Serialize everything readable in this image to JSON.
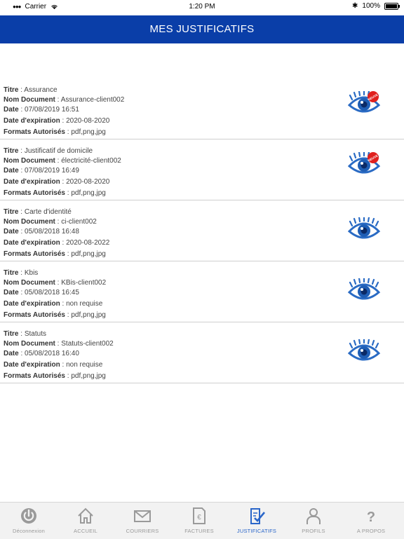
{
  "status_bar": {
    "carrier": "Carrier",
    "time": "1:20 PM",
    "battery": "100%",
    "battery_level": 1.0
  },
  "header": {
    "title": "MES JUSTIFICATIFS"
  },
  "labels": {
    "title": "Titre",
    "doc_name": "Nom Document",
    "date": "Date",
    "expiration": "Date d'expiration",
    "formats": "Formats Autorisés"
  },
  "documents": [
    {
      "titre": "Assurance",
      "nom": "Assurance-client002",
      "date": "07/08/2019 16:51",
      "expiration": "2020-08-2020",
      "formats": "pdf,png,jpg",
      "badge": "NEUVE"
    },
    {
      "titre": "Justificatif de domicile",
      "nom": "électricité-client002",
      "date": "07/08/2019 16:49",
      "expiration": "2020-08-2020",
      "formats": "pdf,png,jpg",
      "badge": "NEUVE"
    },
    {
      "titre": "Carte d'identité",
      "nom": "ci-client002",
      "date": "05/08/2018 16:48",
      "expiration": "2020-08-2022",
      "formats": "pdf,png,jpg",
      "badge": ""
    },
    {
      "titre": "Kbis",
      "nom": "KBis-client002",
      "date": "05/08/2018 16:45",
      "expiration": "non requise",
      "formats": "pdf,png,jpg",
      "badge": ""
    },
    {
      "titre": "Statuts",
      "nom": "Statuts-client002",
      "date": "05/08/2018 16:40",
      "expiration": "non requise",
      "formats": "pdf,png,jpg",
      "badge": ""
    }
  ],
  "tabs": [
    {
      "label": "Déconnexion",
      "icon": "power-icon"
    },
    {
      "label": "ACCUEIL",
      "icon": "home-icon"
    },
    {
      "label": "COURRIERS",
      "icon": "envelope-icon"
    },
    {
      "label": "FACTURES",
      "icon": "invoice-euro-icon"
    },
    {
      "label": "JUSTIFICATIFS",
      "icon": "document-check-icon",
      "active": true
    },
    {
      "label": "PROFILS",
      "icon": "person-icon"
    },
    {
      "label": "A PROPOS",
      "icon": "question-icon"
    }
  ],
  "colors": {
    "header": "#0a3ea8",
    "eye": "#2a6bc4",
    "badge": "#e0201d",
    "active_tab": "#2a66c9"
  }
}
